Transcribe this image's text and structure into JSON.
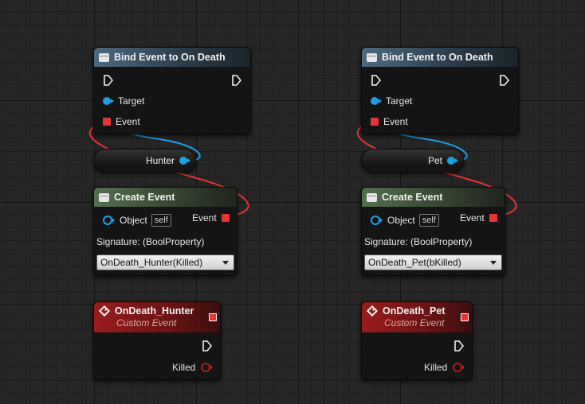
{
  "graph": {
    "left": {
      "bind": {
        "title": "Bind Event to On Death",
        "target_label": "Target",
        "event_label": "Event"
      },
      "variable": {
        "label": "Hunter"
      },
      "create": {
        "title": "Create Event",
        "object_label": "Object",
        "self_label": "self",
        "event_label": "Event",
        "signature": "Signature: (BoolProperty)",
        "selected": "OnDeath_Hunter(Killed)"
      },
      "custom": {
        "title": "OnDeath_Hunter",
        "subtitle": "Custom Event",
        "param_label": "Killed"
      }
    },
    "right": {
      "bind": {
        "title": "Bind Event to On Death",
        "target_label": "Target",
        "event_label": "Event"
      },
      "variable": {
        "label": "Pet"
      },
      "create": {
        "title": "Create Event",
        "object_label": "Object",
        "self_label": "self",
        "event_label": "Event",
        "signature": "Signature: (BoolProperty)",
        "selected": "OnDeath_Pet(bKilled)"
      },
      "custom": {
        "title": "OnDeath_Pet",
        "subtitle": "Custom Event",
        "param_label": "Killed"
      }
    }
  },
  "colors": {
    "object_wire": "#1aa0e6",
    "delegate_wire": "#e83434",
    "bool_pin": "#b81818",
    "function_header": "#4c6a80",
    "create_event_header": "#53704f",
    "custom_event_header": "#9b1c1c"
  }
}
